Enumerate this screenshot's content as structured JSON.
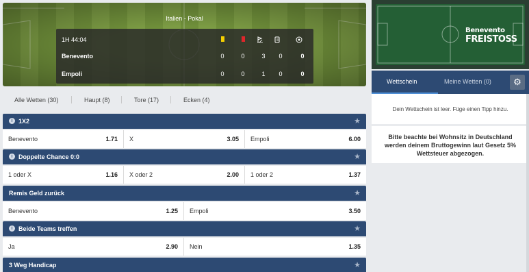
{
  "scoreboard": {
    "league": "Italien - Pokal",
    "time": "1H 44:04",
    "teams": [
      {
        "name": "Benevento",
        "stats": [
          "0",
          "0",
          "3",
          "0",
          "0"
        ]
      },
      {
        "name": "Empoli",
        "stats": [
          "0",
          "0",
          "1",
          "0",
          "0"
        ]
      }
    ],
    "stat_icons": [
      "yellow-card-icon",
      "red-card-icon",
      "corner-flag-icon",
      "substitution-icon",
      "goal-ball-icon"
    ],
    "colors": {
      "yellow_card": "#f5d000",
      "red_card": "#e0262b"
    }
  },
  "filter_tabs": [
    {
      "label": "Alle Wetten (30)"
    },
    {
      "label": "Haupt (8)"
    },
    {
      "label": "Tore (17)"
    },
    {
      "label": "Ecken (4)"
    }
  ],
  "markets": [
    {
      "title": "1X2",
      "selections": [
        {
          "name": "Benevento",
          "odds": "1.71"
        },
        {
          "name": "X",
          "odds": "3.05"
        },
        {
          "name": "Empoli",
          "odds": "6.00"
        }
      ]
    },
    {
      "title": "Doppelte Chance 0:0",
      "selections": [
        {
          "name": "1 oder X",
          "odds": "1.16"
        },
        {
          "name": "X oder 2",
          "odds": "2.00"
        },
        {
          "name": "1 oder 2",
          "odds": "1.37"
        }
      ]
    },
    {
      "title": "Remis Geld zurück",
      "selections": [
        {
          "name": "Benevento",
          "odds": "1.25"
        },
        {
          "name": "Empoli",
          "odds": "3.50"
        }
      ]
    },
    {
      "title": "Beide Teams treffen",
      "selections": [
        {
          "name": "Ja",
          "odds": "2.90"
        },
        {
          "name": "Nein",
          "odds": "1.35"
        }
      ]
    },
    {
      "title": "3 Weg Handicap",
      "selections": []
    }
  ],
  "promo": {
    "line1": "Benevento",
    "line2": "FREISTOSS"
  },
  "betslip": {
    "tab_active": "Wettschein",
    "tab_other": "Meine Wetten (0)",
    "empty_message": "Dein Wettschein ist leer. Füge einen Tipp hinzu.",
    "notice": "Bitte beachte bei Wohnsitz in Deutschland werden deinem Bruttogewinn laut Gesetz 5% Wettsteuer abgezogen."
  },
  "colors": {
    "market_header": "#2d4a73",
    "accent_underline": "#4f8fd6"
  }
}
